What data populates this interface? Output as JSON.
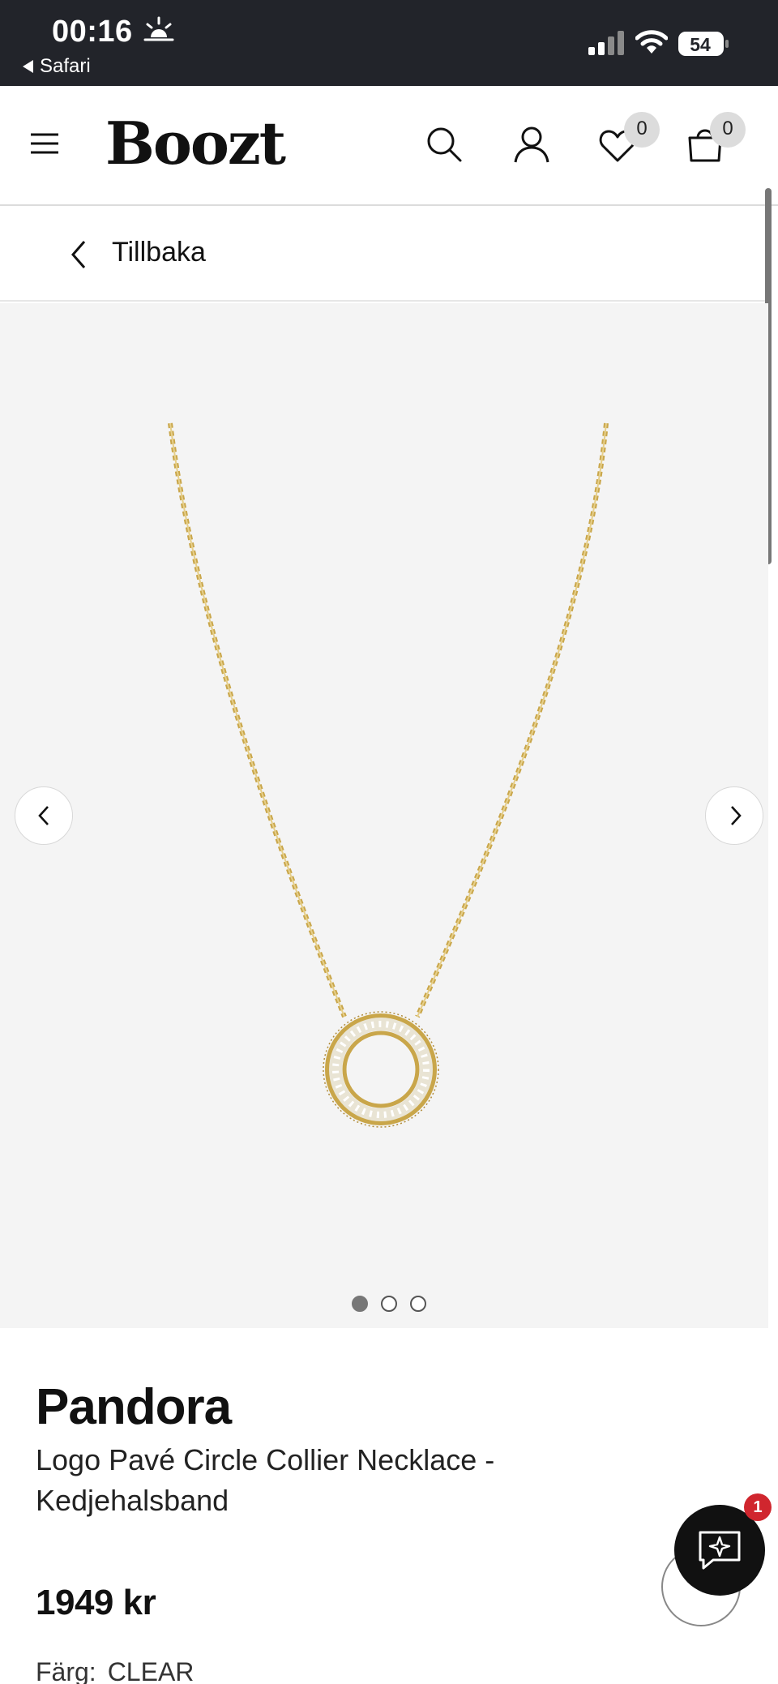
{
  "status_bar": {
    "time": "00:16",
    "back_app": "Safari",
    "battery": "54",
    "icons": [
      "sunrise-icon",
      "signal-icon",
      "wifi-icon",
      "battery-icon"
    ]
  },
  "header": {
    "logo": "Boozt",
    "wishlist_count": "0",
    "cart_count": "0",
    "icons": [
      "menu-icon",
      "search-icon",
      "account-icon",
      "heart-icon",
      "bag-icon"
    ]
  },
  "back_bar": {
    "label": "Tillbaka"
  },
  "gallery": {
    "image_count": 3,
    "active_index": 0,
    "icons": [
      "chevron-left-icon",
      "chevron-right-icon"
    ]
  },
  "product": {
    "brand": "Pandora",
    "name": "Logo Pavé Circle Collier Necklace - Kedjehalsband",
    "price": "1949 kr",
    "color_label": "Färg:",
    "color_value": "CLEAR"
  },
  "chat": {
    "badge_count": "1",
    "icons": [
      "chat-sparkle-icon"
    ]
  },
  "colors": {
    "status_bar_bg": "#22242a",
    "gallery_bg": "#f4f4f4",
    "badge_red": "#d0262e",
    "gold": "#c9a64a"
  }
}
